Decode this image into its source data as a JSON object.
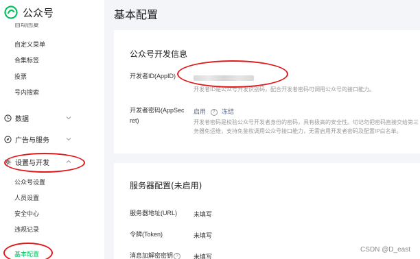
{
  "brand": {
    "name": "公众号",
    "accent": "#07c160"
  },
  "sidebar": {
    "cut_item": "自动回复",
    "items_top": [
      "自定义菜单",
      "合集标签",
      "投票",
      "号内搜索"
    ],
    "groups": [
      {
        "label": "数据",
        "icon": "clock-icon",
        "chevron": "down"
      },
      {
        "label": "广告与服务",
        "icon": "compass-icon",
        "chevron": "down"
      },
      {
        "label": "设置与开发",
        "icon": "gear-icon",
        "chevron": "up"
      }
    ],
    "items_bottom": [
      "公众号设置",
      "人员设置",
      "安全中心",
      "违规记录",
      "基本配置"
    ]
  },
  "page_title": "基本配置",
  "developer": {
    "title": "公众号开发信息",
    "appid_label": "开发者ID(AppID)",
    "appid_desc": "开发者ID是公众号开发识别码，配合开发者密码可调用公众号的接口能力。",
    "secret_label_1": "开发者密码(AppSec",
    "secret_label_2": "ret)",
    "secret_status": "启用",
    "secret_help": "?",
    "secret_action": "冻结",
    "secret_desc_1": "开发者密码是校验公众号开发者身份的密码，具有极高的安全性。切记勿把密码直接交给第三",
    "secret_desc_2": "务器免运维，支持免鉴权调用公众号接口能力，无需启用开发者密码及配置IP白名单。"
  },
  "server": {
    "title": "服务器配置(未启用)",
    "rows": [
      {
        "label": "服务器地址(URL)",
        "value": "未填写"
      },
      {
        "label": "令牌(Token)",
        "value": "未填写"
      },
      {
        "label": "消息加解密密钥",
        "value": "未填写"
      }
    ],
    "help": "?"
  },
  "watermark": "CSDN @D_east",
  "annotation_color": "#e0181b"
}
